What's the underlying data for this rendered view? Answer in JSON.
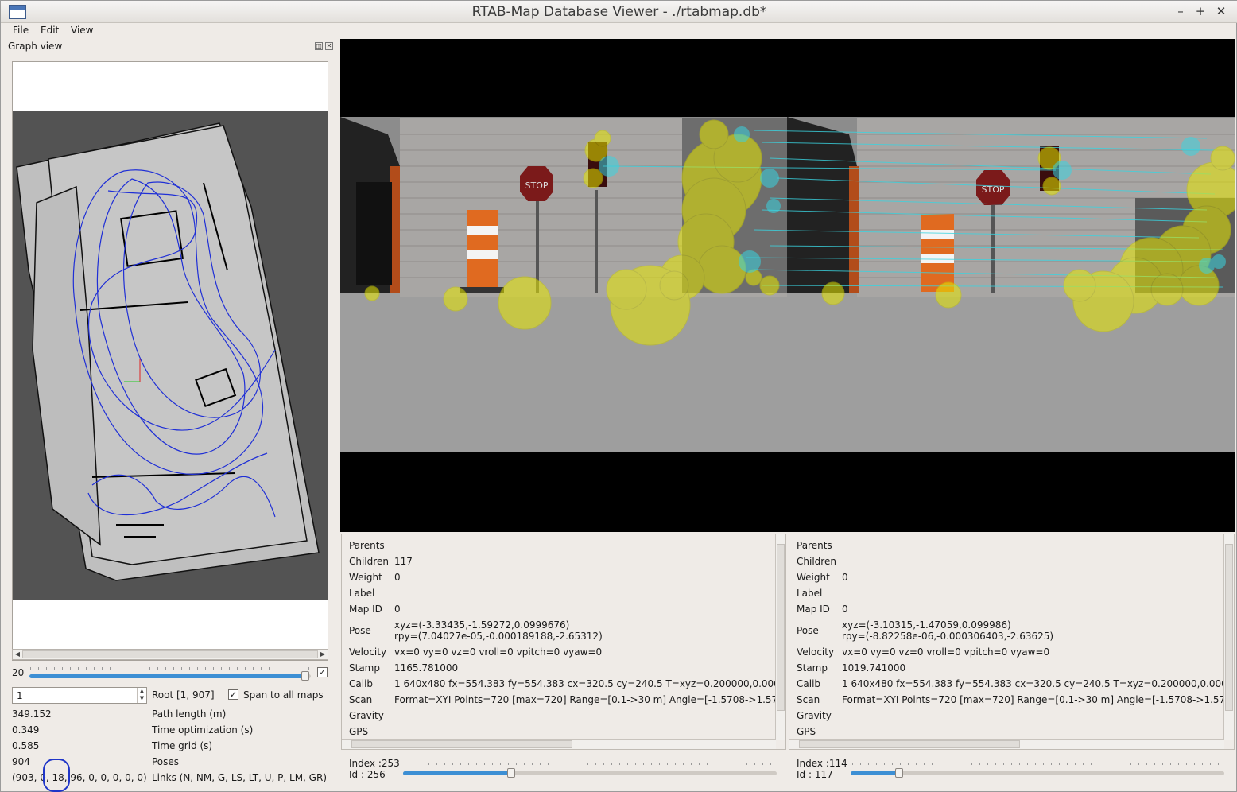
{
  "window": {
    "title": "RTAB-Map Database Viewer - ./rtabmap.db*",
    "minimize": "–",
    "maximize": "+",
    "close": "✕"
  },
  "menu": [
    "File",
    "Edit",
    "View"
  ],
  "dock": {
    "title": "Graph view",
    "float_icon": "◫",
    "close_icon": "✕"
  },
  "graph_controls": {
    "slider_value": "20",
    "slider_fill": 0.98,
    "checkbox_checked": "✓",
    "spin_value": "1",
    "root_label": "Root [1, 907]",
    "span_checked": "✓",
    "span_label": "Span to all maps"
  },
  "stats": [
    {
      "value": "349.152",
      "label": "Path length (m)"
    },
    {
      "value": "0.349",
      "label": "Time optimization (s)"
    },
    {
      "value": "0.585",
      "label": "Time grid (s)"
    },
    {
      "value": "904",
      "label": "Poses"
    },
    {
      "value": "(903, 0, 18, 96, 0, 0, 0, 0, 0)",
      "label": "Links (N, NM, G, LS, LT, U, P, LM, GR)"
    }
  ],
  "left_info": {
    "labels": [
      "Parents",
      "Children",
      "Weight",
      "Label",
      "Map ID",
      "Pose",
      "Velocity",
      "Stamp",
      "Calib",
      "Scan",
      "Gravity",
      "GPS"
    ],
    "children": "117",
    "weight": "0",
    "map_id": "0",
    "pose_xyz": "xyz=(-3.33435,-1.59272,0.0999676)",
    "pose_rpy": "rpy=(7.04027e-05,-0.000189188,-2.65312)",
    "velocity": "vx=0 vy=0 vz=0 vroll=0 vpitch=0 vyaw=0",
    "stamp": "1165.781000",
    "calib": "1 640x480 fx=554.383 fy=554.383 cx=320.5 cy=240.5 T=xyz=0.200000,0.000",
    "scan": "Format=XYI Points=720 [max=720] Range=[0.1->30 m] Angle=[-1.5708->1.57"
  },
  "right_info": {
    "labels": [
      "Parents",
      "Children",
      "Weight",
      "Label",
      "Map ID",
      "Pose",
      "Velocity",
      "Stamp",
      "Calib",
      "Scan",
      "Gravity",
      "GPS"
    ],
    "weight": "0",
    "map_id": "0",
    "pose_xyz": "xyz=(-3.10315,-1.47059,0.099986)",
    "pose_rpy": "rpy=(-8.82258e-06,-0.000306403,-2.63625)",
    "velocity": "vx=0 vy=0 vz=0 vroll=0 vpitch=0 vyaw=0",
    "stamp": "1019.741000",
    "calib": "1 640x480 fx=554.383 fy=554.383 cx=320.5 cy=240.5 T=xyz=0.200000,0.000",
    "scan": "Format=XYI Points=720 [max=720] Range=[0.1->30 m] Angle=[-1.5708->1.57"
  },
  "left_index": {
    "index": "Index :253",
    "id": "Id :   256",
    "fill": 0.29
  },
  "right_index": {
    "index": "Index :114",
    "id": "Id :   117",
    "fill": 0.13
  },
  "scene": {
    "stop_sign_text": "STOP"
  },
  "colors": {
    "trajectory": "#1f2fd6",
    "feature": "#e8e800",
    "match": "#3ad4e0"
  }
}
